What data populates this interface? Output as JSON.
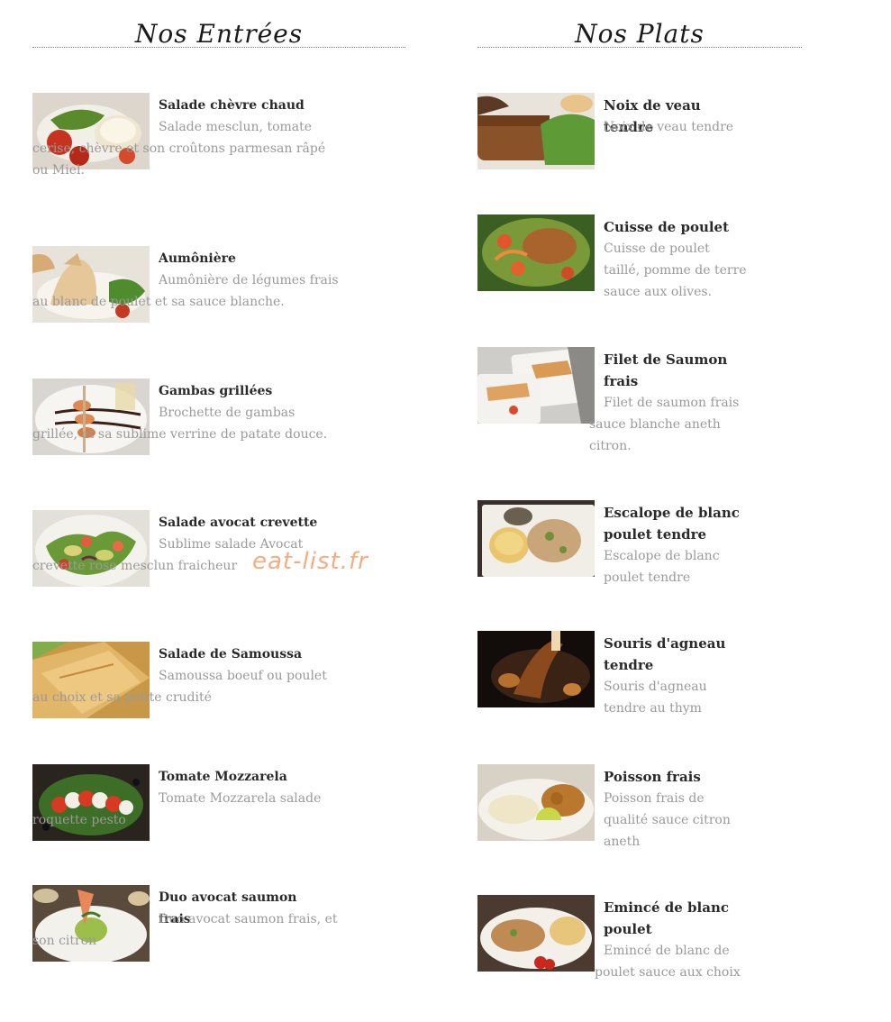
{
  "entrees": {
    "title": "Nos Entrées",
    "items": [
      {
        "name": "Salade chèvre chaud",
        "desc": "Salade mesclun, tomate cerise, chèvre et son croûtons  parmesan râpé ou Miel."
      },
      {
        "name": "Aumônière",
        "desc": "Aumônière de légumes frais au blanc de poulet et sa sauce blanche."
      },
      {
        "name": "Gambas grillées",
        "desc": "Brochette de gambas grillée, et sa sublime verrine de patate douce."
      },
      {
        "name": "Salade avocat crevette",
        "desc": "Sublime salade Avocat crevette rose mesclun fraicheur"
      },
      {
        "name": "Salade de Samoussa",
        "desc": "Samoussa boeuf ou poulet au choix et sa petite crudité"
      },
      {
        "name": "Tomate Mozzarela",
        "desc": "Tomate Mozzarela salade roquette pesto"
      },
      {
        "name": "Duo avocat saumon frais",
        "desc": "Duo avocat saumon frais, et son citron"
      }
    ]
  },
  "plats": {
    "title": "Nos Plats",
    "items": [
      {
        "name": "Noix de veau tendre",
        "desc": "Noix de veau tendre"
      },
      {
        "name": "Cuisse de poulet",
        "desc": "Cuisse de poulet taillé, pomme de terre sauce aux olives."
      },
      {
        "name": "Filet de Saumon frais",
        "desc": "Filet de saumon frais sauce blanche aneth citron."
      },
      {
        "name": "Escalope de blanc poulet tendre",
        "desc": "Escalope de blanc poulet tendre"
      },
      {
        "name": "Souris d'agneau tendre",
        "desc": "Souris d'agneau tendre au thym"
      },
      {
        "name": "Poisson frais",
        "desc": "Poisson frais de qualité sauce citron aneth"
      },
      {
        "name": "Emincé de blanc poulet",
        "desc": "Emincé de blanc de poulet sauce aux choix"
      }
    ]
  },
  "watermark": "eat-list.fr"
}
